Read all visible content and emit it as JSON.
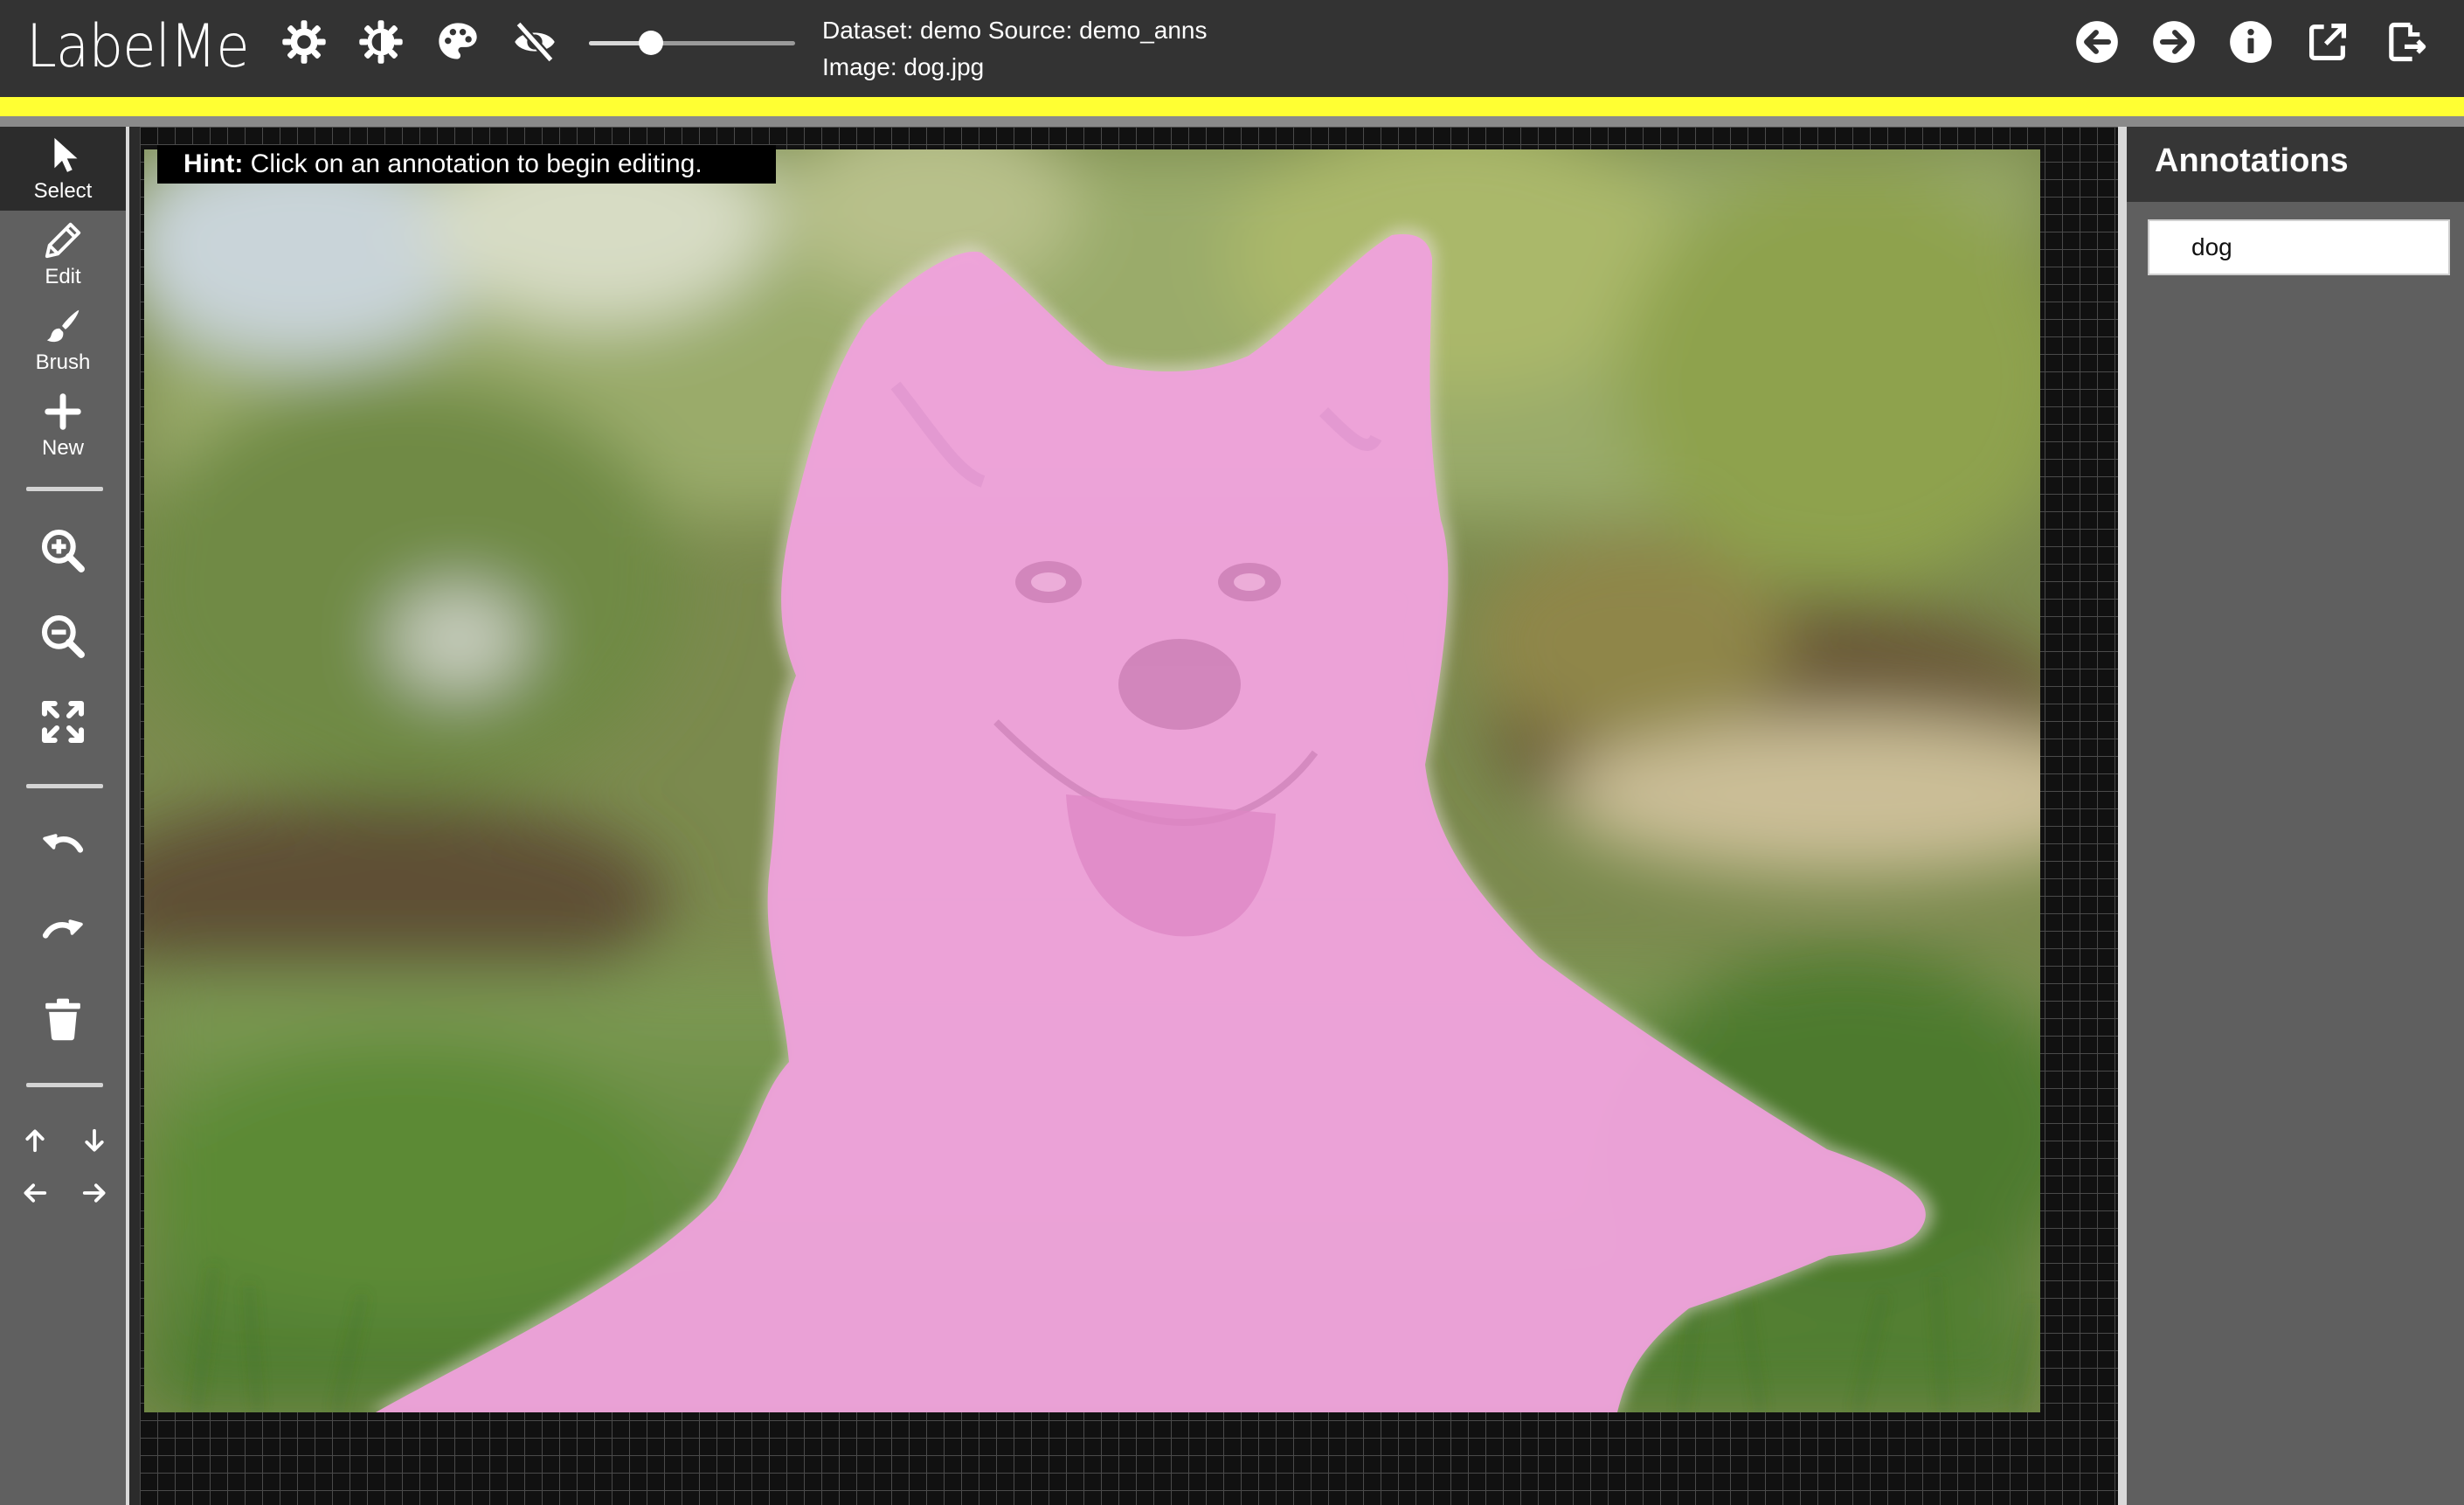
{
  "app": {
    "title": "LabelMe"
  },
  "header": {
    "dataset_line": "Dataset: demo Source: demo_anns",
    "image_line": "Image: dog.jpg",
    "opacity_slider": {
      "value": 0.3
    },
    "left_icons": [
      "brightness-icon",
      "contrast-icon",
      "palette-icon",
      "hide-annotations-icon"
    ],
    "right_icons": [
      "previous-image-icon",
      "next-image-icon",
      "info-icon",
      "open-external-icon",
      "export-icon"
    ]
  },
  "toolbar": {
    "tools": [
      {
        "label": "Select",
        "icon": "cursor-icon",
        "active": true
      },
      {
        "label": "Edit",
        "icon": "pencil-icon",
        "active": false
      },
      {
        "label": "Brush",
        "icon": "brush-icon",
        "active": false
      },
      {
        "label": "New",
        "icon": "plus-icon",
        "active": false
      }
    ],
    "view_icons": [
      "zoom-in-icon",
      "zoom-out-icon",
      "fit-screen-icon"
    ],
    "history_icons": [
      "undo-icon",
      "redo-icon",
      "delete-icon"
    ],
    "nav_icons": [
      "arrow-up-icon",
      "arrow-down-icon",
      "arrow-left-icon",
      "arrow-right-icon"
    ]
  },
  "canvas": {
    "hint_label": "Hint:",
    "hint_text": "Click on an annotation to begin editing.",
    "mask_color": "#f0a0dc"
  },
  "annotations_panel": {
    "title": "Annotations",
    "items": [
      {
        "label": "dog"
      }
    ]
  },
  "colors": {
    "topbar": "#333333",
    "accent_bar": "#ffff33",
    "toolbar": "#606060",
    "panel": "#5f5f5f"
  }
}
